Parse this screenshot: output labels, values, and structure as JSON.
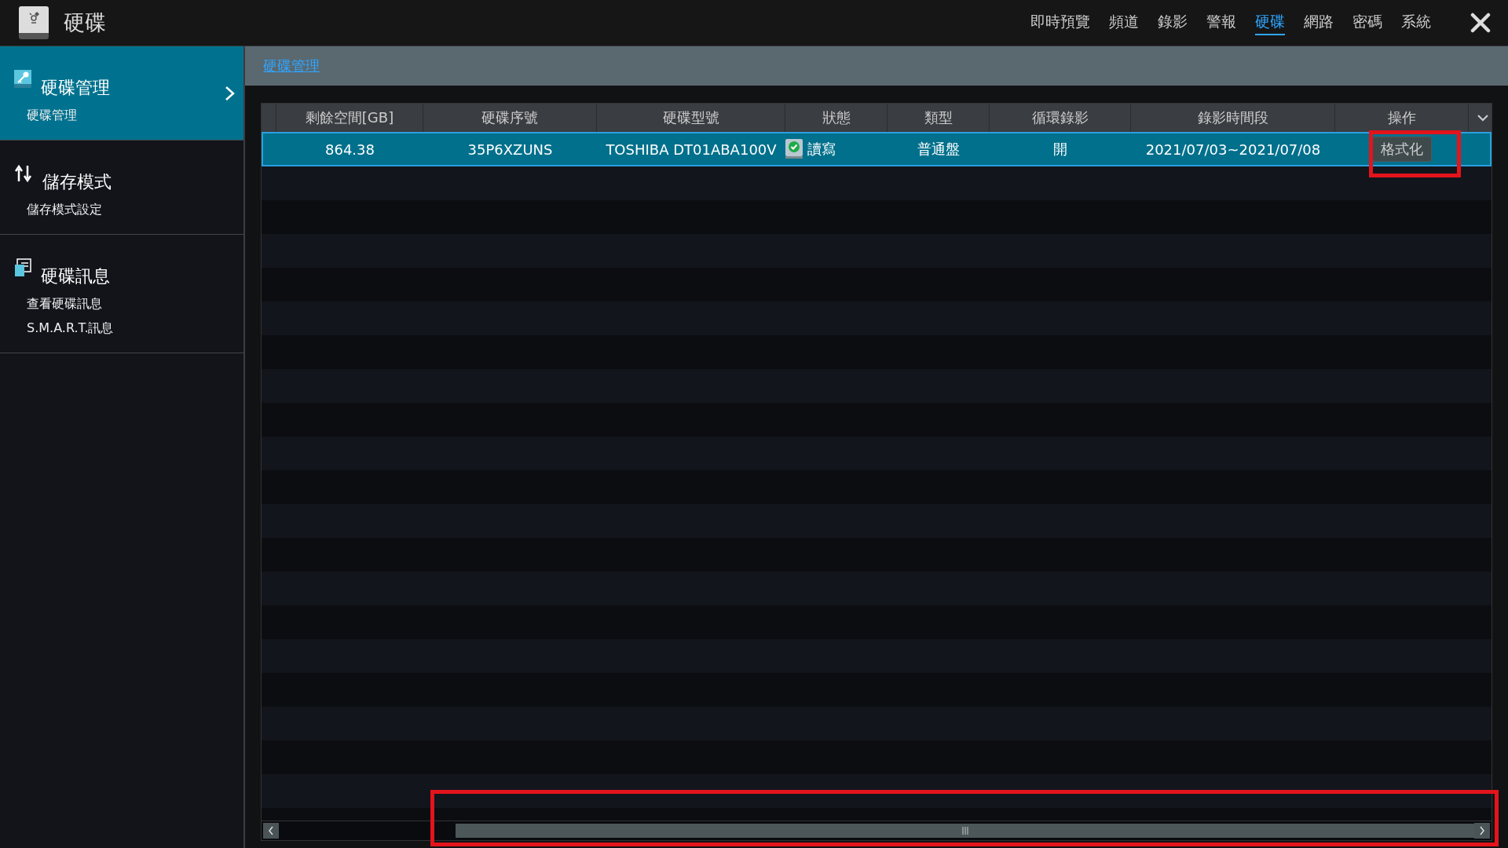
{
  "window": {
    "title": "硬碟"
  },
  "nav": [
    {
      "label": "即時預覽",
      "selected": false
    },
    {
      "label": "頻道",
      "selected": false
    },
    {
      "label": "錄影",
      "selected": false
    },
    {
      "label": "警報",
      "selected": false
    },
    {
      "label": "硬碟",
      "selected": true
    },
    {
      "label": "網路",
      "selected": false
    },
    {
      "label": "密碼",
      "selected": false
    },
    {
      "label": "系統",
      "selected": false
    }
  ],
  "sidebar": [
    {
      "title": "硬碟管理",
      "kind": "key",
      "selected": true,
      "links": [
        "硬碟管理"
      ]
    },
    {
      "title": "儲存模式",
      "kind": "arrows",
      "selected": false,
      "links": [
        "儲存模式設定"
      ]
    },
    {
      "title": "硬碟訊息",
      "kind": "doc",
      "selected": false,
      "links": [
        "查看硬碟訊息",
        "S.M.A.R.T.訊息"
      ]
    }
  ],
  "breadcrumb": "硬碟管理",
  "table": {
    "columns": [
      "剩餘空間[GB]",
      "硬碟序號",
      "硬碟型號",
      "狀態",
      "類型",
      "循環錄影",
      "錄影時間段",
      "操作"
    ],
    "rows": [
      {
        "selected": true,
        "cells": [
          "864.38",
          "35P6XZUNS",
          "TOSHIBA DT01ABA100V",
          "讀寫",
          "普通盤",
          "開",
          "2021/07/03~2021/07/08"
        ],
        "status_ok": true,
        "action": "格式化"
      }
    ]
  }
}
